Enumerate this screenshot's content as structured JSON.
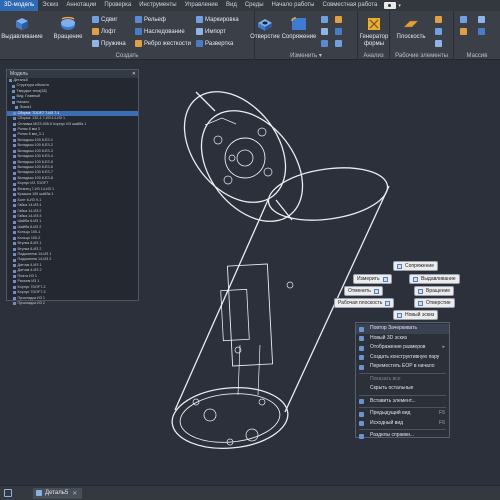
{
  "ribbon_tabs": {
    "items": [
      "3D-модель",
      "Эскиз",
      "Аннотации",
      "Проверка",
      "Инструменты",
      "Управление",
      "Вид",
      "Среды",
      "Начало работы",
      "Совместная работа"
    ],
    "active_index": 0
  },
  "ribbon": {
    "create": {
      "label": "Создать",
      "extrude": "Выдавливание",
      "revolve": "Вращение",
      "sweep": "Сдвиг",
      "loft": "Лофт",
      "coil": "Пружина",
      "emboss": "Рельеф",
      "derive": "Наследование",
      "rib": "Ребро жесткости",
      "mark": "Маркировка",
      "import": "Импорт",
      "unwrap": "Развертка"
    },
    "modify": {
      "label": "Изменить",
      "label_suffix": "▾",
      "hole": "Отверстие",
      "fillet": "Сопряжение"
    },
    "explore": {
      "label": "Анализ",
      "generate_shape": "Генератор формы"
    },
    "work_features": {
      "label": "Рабочие элементы",
      "plane": "Плоскость"
    },
    "pattern": {
      "label": "Массив"
    }
  },
  "browser": {
    "title": "Модель",
    "selected_index": 6,
    "rows": [
      "Деталь5",
      "Структура объекта",
      "Твердые тела(38)",
      "Вид: Главный",
      "Начало",
      "Эскиз1",
      "Сборка: 7DOF7 7-ИЗ 7:1",
      "Сборка: 132-1 7-ИЗ:14-ИЗ 1",
      "Оплавка МОЗ-005-К Корпус ИЗ шайба 1",
      "Ролик 8 мм 3",
      "Ролик 8 мм_3-1",
      "Вкладыш 100 8-ЕЗ-1",
      "Вкладыш 100 8-ЕЗ-2",
      "Вкладыш 100 8-ЕЗ-3",
      "Вкладыш 100 8-ЕЗ-4",
      "Вкладыш 100 8-ЕЗ-5",
      "Вкладыш 100 8-ЕЗ-6",
      "Вкладыш 100 8-ЕЗ-7",
      "Вкладыш 100 8-ЕЗ-8",
      "Корпус ИЗ 7DOF7",
      "Фланец 7-ИЗ 14-ИЗ 1",
      "Крышка 100 шайба 1",
      "Болт 6-ИЗ 9-1",
      "Гайка 14-ИЗ:1",
      "Гайка 14-ИЗ:2",
      "Гайка 14-ИЗ:3",
      "Шайба 6-ИЗ 1",
      "Шайба 6-ИЗ 2",
      "Кольцо 100-1",
      "Кольцо 100-2",
      "Втулка 8-ИЗ 1",
      "Втулка 8-ИЗ 2",
      "Подшипник 14-ИЗ 1",
      "Подшипник 14-ИЗ 2",
      "Датчик 4-ИЗ 1",
      "Датчик 4-ИЗ 2",
      "Плата ИЗ 1",
      "Разъем ИЗ 1",
      "Корпус 7DOF7-2",
      "Корпус 7DOF7-3",
      "Прокладка ИЗ 1",
      "Прокладка ИЗ 2"
    ]
  },
  "marking_menu": {
    "fillet": "Сопряжение",
    "measure": "Измерить",
    "extrude": "Выдавливание",
    "undo": "Отменить",
    "revolve": "Вращение",
    "work_plane": "Рабочая плоскость",
    "hole": "Отверстие",
    "new_sketch": "Новый эскиз"
  },
  "context_menu": {
    "items": [
      {
        "label": "Повтор Зачеркивать",
        "key": "",
        "disabled": false
      },
      {
        "label": "Новый 3D эскиз",
        "key": "",
        "disabled": false
      },
      {
        "label": "Отображение размеров",
        "key": "▸",
        "disabled": false
      },
      {
        "label": "Создать конструктивную пару",
        "key": "",
        "disabled": false
      },
      {
        "label": "Переместить EOP в начало",
        "key": "",
        "disabled": false
      },
      {
        "label": "Показать все",
        "key": "",
        "disabled": true
      },
      {
        "label": "Скрыть остальные",
        "key": "",
        "disabled": false
      },
      {
        "label": "Вставить элемент...",
        "key": "",
        "disabled": false
      },
      {
        "label": "Предыдущий вид",
        "key": "F5",
        "disabled": false
      },
      {
        "label": "Исходный вид",
        "key": "F6",
        "disabled": false
      },
      {
        "label": "Разделы справки...",
        "key": "",
        "disabled": false
      }
    ]
  },
  "status_bar": {
    "document_tab": "Деталь5"
  },
  "colors": {
    "accent": "#2f68b3",
    "canvas": "#2b303a",
    "ribbon": "#3b4048"
  }
}
